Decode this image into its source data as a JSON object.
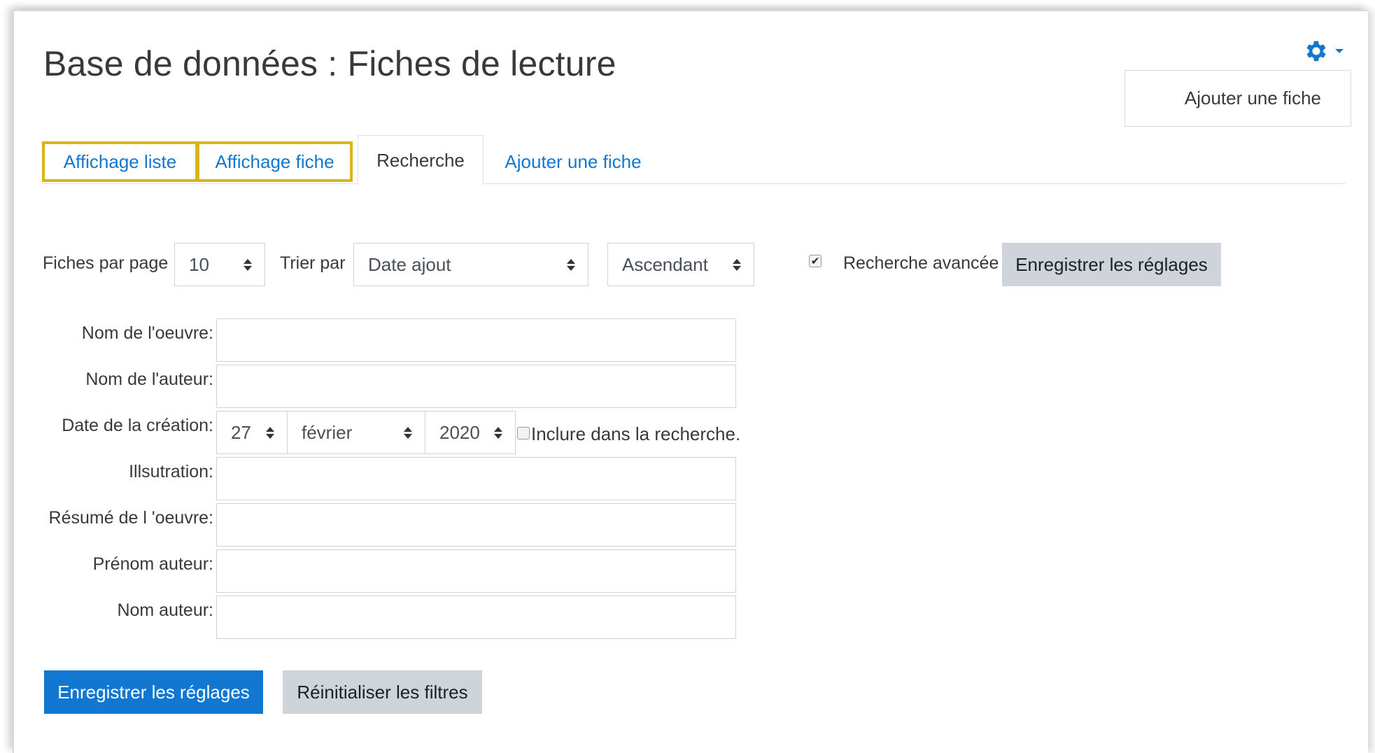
{
  "page": {
    "title": "Base de données : Fiches de lecture",
    "top_add_button": "Ajouter une fiche"
  },
  "colors": {
    "link": "#1177d1",
    "highlight_border": "#d9b51c",
    "primary_button": "#1177d1",
    "secondary_button": "#ced4da"
  },
  "tabs": [
    {
      "label": "Affichage liste",
      "highlighted": true
    },
    {
      "label": "Affichage fiche",
      "highlighted": true
    },
    {
      "label": "Recherche",
      "active": true
    },
    {
      "label": "Ajouter une fiche"
    }
  ],
  "controls": {
    "per_page_label": "Fiches par page",
    "per_page_value": "10",
    "sort_label": "Trier par",
    "sort_value": "Date ajout",
    "order_value": "Ascendant",
    "advanced_checked": true,
    "advanced_label": "Recherche avancée",
    "save_settings": "Enregistrer les réglages"
  },
  "fields": {
    "work_name": {
      "label": "Nom de l'oeuvre:",
      "value": ""
    },
    "author_name": {
      "label": "Nom de l'auteur:",
      "value": ""
    },
    "creation_date": {
      "label": "Date de la création:",
      "day": "27",
      "month": "février",
      "year": "2020",
      "include_checked": false,
      "include_label": "Inclure dans la recherche."
    },
    "illustration": {
      "label": "Illsutration:",
      "value": ""
    },
    "summary": {
      "label": "Résumé de l 'oeuvre:",
      "value": ""
    },
    "author_firstname": {
      "label": "Prénom auteur:",
      "value": ""
    },
    "author_lastname": {
      "label": "Nom auteur:",
      "value": ""
    }
  },
  "buttons": {
    "save": "Enregistrer les réglages",
    "reset": "Réinitialiser les filtres"
  },
  "icons": {
    "settings": "gear-icon",
    "dropdown": "caret-down-icon",
    "select": "sort-caret-icon"
  }
}
